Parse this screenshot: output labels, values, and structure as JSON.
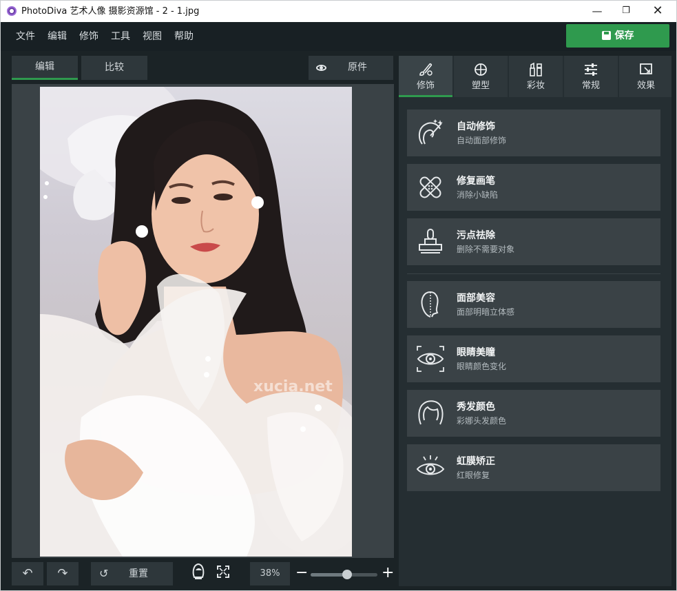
{
  "window": {
    "title": "PhotoDiva 艺术人像 摄影资源馆 - 2 - 1.jpg",
    "controls": {
      "minimize": "—",
      "maximize": "❐",
      "close": "✕"
    }
  },
  "menu": {
    "items": [
      "文件",
      "编辑",
      "修饰",
      "工具",
      "视图",
      "帮助"
    ]
  },
  "save_label": "保存",
  "view_tabs": {
    "edit": "编辑",
    "compare": "比较",
    "original": "原件"
  },
  "photo": {
    "watermark": "xucia.net"
  },
  "bottom": {
    "undo": "↶",
    "redo": "↷",
    "reset_icon": "↺",
    "reset": "重置",
    "zoom": "38%",
    "zoom_minus": "−",
    "zoom_plus": "+",
    "zoom_level": 0.55
  },
  "tool_tabs": [
    {
      "label": "修饰",
      "icon": "brush-icon",
      "active": true
    },
    {
      "label": "塑型",
      "icon": "shape-icon",
      "active": false
    },
    {
      "label": "彩妆",
      "icon": "makeup-icon",
      "active": false
    },
    {
      "label": "常规",
      "icon": "sliders-icon",
      "active": false
    },
    {
      "label": "效果",
      "icon": "effects-icon",
      "active": false
    }
  ],
  "tools": [
    {
      "title": "自动修饰",
      "subtitle": "自动面部修饰",
      "icon": "auto-retouch-icon"
    },
    {
      "title": "修复画笔",
      "subtitle": "消除小缺陷",
      "icon": "bandage-icon"
    },
    {
      "title": "污点祛除",
      "subtitle": "删除不需要对象",
      "icon": "stamp-icon"
    },
    {
      "title": "面部美容",
      "subtitle": "面部明暗立体感",
      "icon": "face-contour-icon"
    },
    {
      "title": "眼睛美瞳",
      "subtitle": "眼睛颜色变化",
      "icon": "eye-color-icon"
    },
    {
      "title": "秀发颜色",
      "subtitle": "彩娜头发颜色",
      "icon": "hair-icon"
    },
    {
      "title": "虹膜矫正",
      "subtitle": "红眼修复",
      "icon": "iris-icon"
    }
  ],
  "colors": {
    "accent": "#2f9a4e",
    "panel": "#252e32",
    "card": "#3a4246"
  }
}
